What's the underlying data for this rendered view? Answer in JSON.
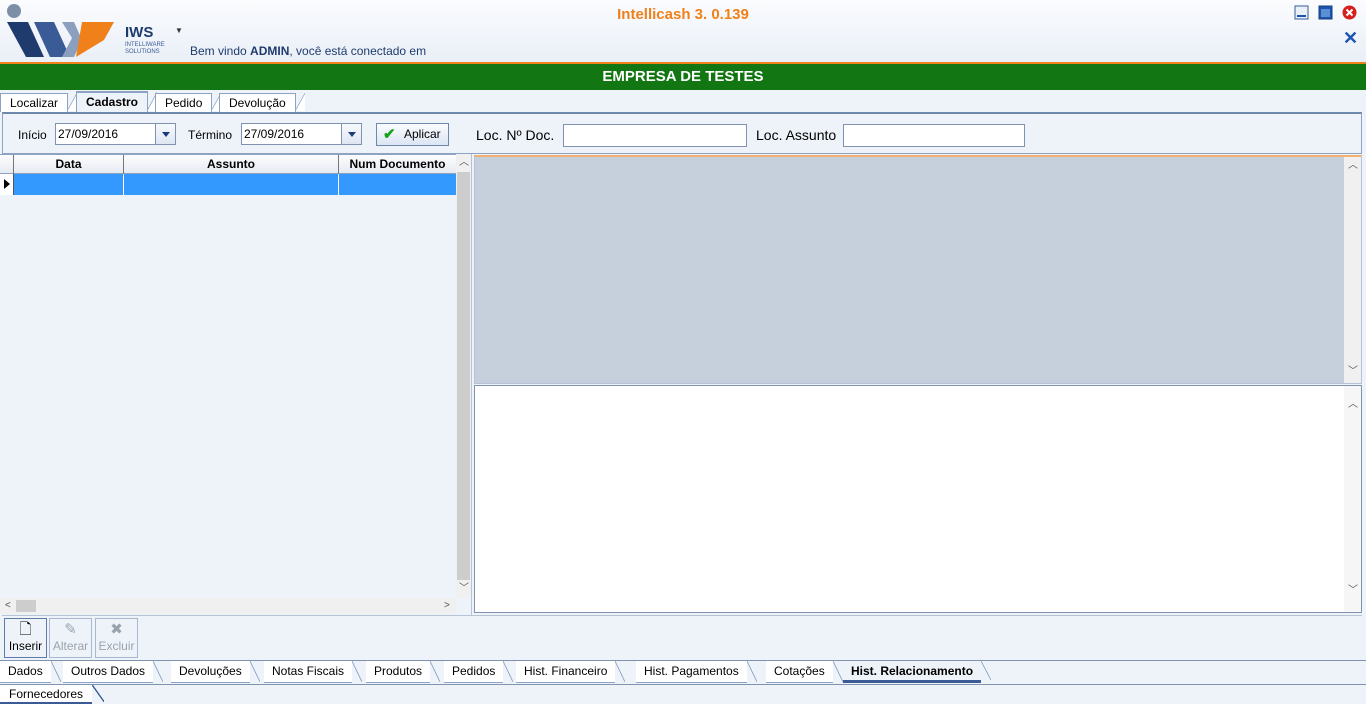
{
  "app": {
    "title": "Intellicash 3. 0.139",
    "logo_text": "IWS",
    "logo_subtext": "INTELLIWARE SOLUTIONS",
    "welcome_prefix": "Bem vindo ",
    "welcome_user": "ADMIN",
    "welcome_suffix": ", você está conectado em",
    "company": "EMPRESA DE TESTES"
  },
  "colors": {
    "accent": "#f0801a",
    "company_bar": "#127612",
    "selection": "#3399ff"
  },
  "window_icons": [
    "minimize-icon",
    "maximize-icon",
    "close-icon"
  ],
  "top_tabs": [
    {
      "label": "Localizar",
      "active": false
    },
    {
      "label": "Cadastro",
      "active": true
    },
    {
      "label": "Pedido",
      "active": false
    },
    {
      "label": "Devolução",
      "active": false
    }
  ],
  "filters": {
    "start_label": "Início",
    "start_value": "27/09/2016",
    "end_label": "Término",
    "end_value": "27/09/2016",
    "apply_label": "Aplicar",
    "doc_label": "Loc. Nº Doc.",
    "doc_value": "",
    "subject_label": "Loc. Assunto",
    "subject_value": ""
  },
  "grid": {
    "columns": [
      "Data",
      "Assunto",
      "Num Documento"
    ],
    "rows": [
      [
        "",
        "",
        ""
      ]
    ]
  },
  "actions": {
    "insert": "Inserir",
    "edit": "Alterar",
    "delete": "Excluir"
  },
  "bottom_tabs": [
    {
      "label": "Dados",
      "active": false
    },
    {
      "label": "Outros Dados",
      "active": false
    },
    {
      "label": "Devoluções",
      "active": false
    },
    {
      "label": "Notas Fiscais",
      "active": false
    },
    {
      "label": "Produtos",
      "active": false
    },
    {
      "label": "Pedidos",
      "active": false
    },
    {
      "label": "Hist. Financeiro",
      "active": false
    },
    {
      "label": "Hist. Pagamentos",
      "active": false
    },
    {
      "label": "Cotações",
      "active": false
    },
    {
      "label": "Hist. Relacionamento",
      "active": true
    }
  ],
  "bottom_tabs2": [
    {
      "label": "Fornecedores",
      "active": true
    }
  ]
}
